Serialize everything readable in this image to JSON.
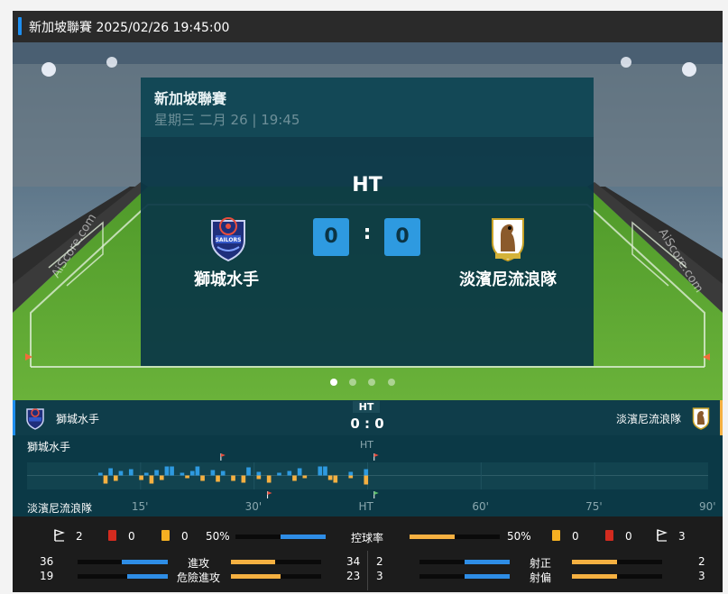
{
  "header": {
    "title": "新加坡聯賽 2025/02/26 19:45:00"
  },
  "hero": {
    "watermark_left": "AiScore.com",
    "watermark_right": "AiScore.com",
    "card": {
      "league": "新加坡聯賽",
      "date": "星期三 二月 26 | 19:45",
      "status": "HT",
      "home_score": "0",
      "colon": ":",
      "away_score": "0",
      "home_team": "獅城水手",
      "away_team": "淡濱尼流浪隊",
      "home_badge_text": "SAILORS"
    },
    "carousel": {
      "count": 4,
      "active": 0
    }
  },
  "score_strip": {
    "home_team": "獅城水手",
    "away_team": "淡濱尼流浪隊",
    "status": "HT",
    "score": "0 : 0"
  },
  "timeline": {
    "home_label": "獅城水手",
    "away_label": "淡濱尼流浪隊",
    "ht_label": "HT",
    "ticks": [
      "15'",
      "30'",
      "HT",
      "60'",
      "75'",
      "90'"
    ],
    "colors": {
      "home": "#2e9ae0",
      "away": "#f5b041"
    },
    "momentum_home": [
      0,
      0,
      0,
      0,
      0,
      0,
      3,
      0,
      8,
      0,
      5,
      0,
      7,
      0,
      0,
      3,
      0,
      6,
      0,
      10,
      10,
      0,
      3,
      0,
      5,
      10,
      0,
      0,
      6,
      0,
      5,
      0,
      0,
      0,
      0,
      9,
      0,
      4,
      0,
      0,
      0,
      3,
      0,
      5,
      0,
      8,
      0,
      0,
      0,
      10,
      10,
      0,
      0,
      0,
      0,
      4,
      0,
      0,
      7,
      0
    ],
    "momentum_away": [
      0,
      0,
      0,
      0,
      0,
      0,
      0,
      9,
      0,
      6,
      0,
      0,
      0,
      0,
      5,
      0,
      9,
      0,
      5,
      0,
      0,
      0,
      0,
      3,
      0,
      0,
      6,
      0,
      0,
      7,
      0,
      0,
      6,
      0,
      8,
      0,
      0,
      4,
      0,
      8,
      0,
      0,
      0,
      0,
      6,
      0,
      3,
      0,
      0,
      0,
      0,
      5,
      8,
      0,
      0,
      3,
      0,
      0,
      10,
      0
    ],
    "events": [
      {
        "type": "corner",
        "side": "home",
        "minute": 23,
        "color": "#e84d3d"
      },
      {
        "type": "corner",
        "side": "away",
        "minute": 30,
        "color": "#e84d3d"
      },
      {
        "type": "corner",
        "side": "away",
        "minute": 46,
        "color": "#5cc06a"
      },
      {
        "type": "corner",
        "side": "home",
        "minute": 46,
        "color": "#e84d3d"
      }
    ]
  },
  "stats": {
    "home_corners": "2",
    "home_red": "0",
    "home_yellow": "0",
    "possession_label": "控球率",
    "home_possession": "50%",
    "away_possession": "50%",
    "away_yellow": "0",
    "away_red": "0",
    "away_corners": "3",
    "home_possession_value": 50,
    "away_possession_value": 50,
    "rows_left": [
      {
        "label": "進攻",
        "home": "36",
        "away": "34",
        "home_value": 36,
        "away_value": 34
      },
      {
        "label": "危險進攻",
        "home": "19",
        "away": "23",
        "home_value": 19,
        "away_value": 23
      }
    ],
    "rows_right": [
      {
        "label": "射正",
        "home": "2",
        "away": "2",
        "home_value": 2,
        "away_value": 2
      },
      {
        "label": "射偏",
        "home": "3",
        "away": "3",
        "home_value": 3,
        "away_value": 3
      }
    ],
    "colors": {
      "home": "#2e8de6",
      "away": "#f5b041",
      "red_card": "#d32b1f",
      "yellow_card": "#f5b022"
    }
  }
}
